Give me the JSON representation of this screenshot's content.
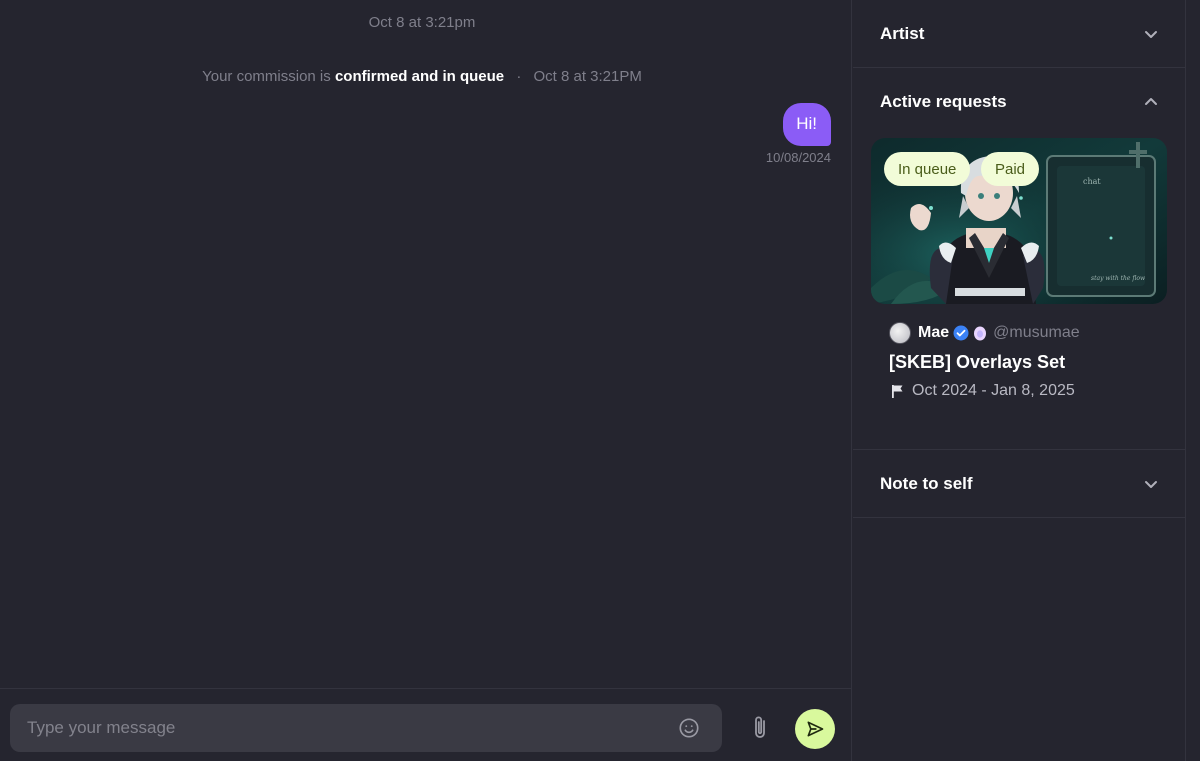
{
  "chat": {
    "top_timestamp": "Oct 8 at 3:21pm",
    "system_message": {
      "prefix": "Your commission is",
      "status": "confirmed and in queue",
      "timestamp": "Oct 8 at 3:21PM"
    },
    "messages": [
      {
        "text": "Hi!",
        "date": "10/08/2024",
        "from": "me"
      }
    ],
    "composer": {
      "placeholder": "Type your message",
      "icons": [
        "emoji-icon",
        "paperclip-icon",
        "send-icon"
      ]
    }
  },
  "sidebar": {
    "artist_section": {
      "label": "Artist",
      "expanded": false
    },
    "active_requests": {
      "label": "Active requests",
      "expanded": true,
      "requests": [
        {
          "badges": [
            "In queue",
            "Paid"
          ],
          "artist_name": "Mae",
          "handle": "@musumae",
          "title": "[SKEB] Overlays Set",
          "dates": "Oct 2024 - Jan 8, 2025"
        }
      ]
    },
    "note_section": {
      "label": "Note to self",
      "expanded": false
    }
  },
  "colors": {
    "background": "#25252f",
    "bubble": "#8b5cf6",
    "send_button": "#d9f99d",
    "badge_bg": "#f2fcd8",
    "badge_text": "#4a5d1a"
  }
}
